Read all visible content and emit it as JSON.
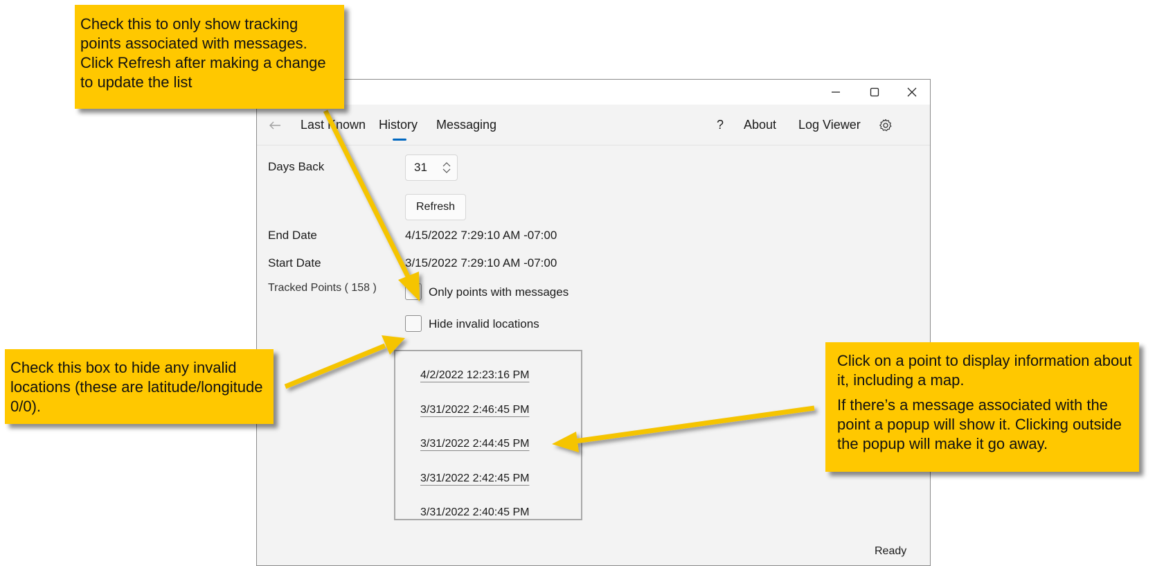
{
  "window": {
    "controls": {
      "minimize": "–",
      "maximize": "☐",
      "close": "✕"
    },
    "status": "Ready"
  },
  "nav": {
    "back_icon": "←",
    "tabs": [
      {
        "label": "Last Known"
      },
      {
        "label": "History",
        "selected": true
      },
      {
        "label": "Messaging"
      }
    ],
    "help_label": "?",
    "about_label": "About",
    "log_viewer_label": "Log Viewer",
    "settings_icon": "gear-icon"
  },
  "form": {
    "days_back_label": "Days Back",
    "days_back_value": "31",
    "refresh_label": "Refresh",
    "end_date_label": "End Date",
    "end_date_value": "4/15/2022 7:29:10 AM -07:00",
    "start_date_label": "Start Date",
    "start_date_value": "3/15/2022 7:29:10 AM -07:00",
    "tracked_points_label": "Tracked Points ( 158 )",
    "only_messages_label": "Only points with messages",
    "only_messages_checked": false,
    "hide_invalid_label": "Hide invalid locations",
    "hide_invalid_checked": false
  },
  "points": [
    "4/2/2022 12:23:16 PM",
    "3/31/2022 2:46:45 PM",
    "3/31/2022 2:44:45 PM",
    "3/31/2022 2:42:45 PM",
    "3/31/2022 2:40:45 PM"
  ],
  "callouts": {
    "top": "Check this to only show tracking points associated with messages. Click Refresh after making a change to update the list",
    "left": "Check this box to hide any invalid locations (these are latitude/longitude 0/0).",
    "right_1": "Click on a point to display information about it, including a map.",
    "right_2": "If there’s a message associated with the point a popup will show it. Clicking outside the popup will make it go away."
  },
  "colors": {
    "callout": "#ffc800",
    "accent": "#0067c0",
    "window_bg": "#f3f3f3"
  }
}
